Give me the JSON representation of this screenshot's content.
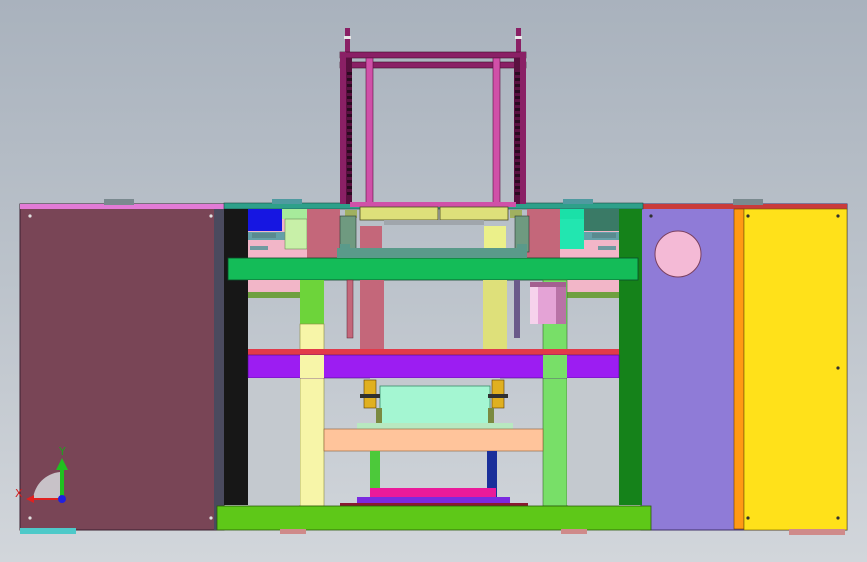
{
  "viewport": {
    "background_top": "#a9b2bd",
    "background_bottom": "#d2d6db"
  },
  "triad": {
    "x_label": "X",
    "y_label": "Y",
    "x_color": "#e02020",
    "y_color": "#20c020",
    "z_color": "#2020e0"
  },
  "model": {
    "colors": {
      "left_cabinet": "#794556",
      "right_cabinet_purple": "#8f7bd7",
      "right_cabinet_yellow": "#ffe11a",
      "dark_post": "#171717",
      "green_base": "#5ec818",
      "green_crossbar": "#14bc58",
      "purple_plate": "#9c1df2",
      "peach_plate": "#ffc49b",
      "mint_block": "#a4f6d2",
      "magenta_frame": "#8a2065",
      "rose_column": "#c4677a",
      "yellow_column": "#ebf08a",
      "light_green_column": "#78df68",
      "dark_green_column": "#15821a",
      "cylinder": "#e4a3d6",
      "pink_disc": "#f4bad6"
    }
  }
}
